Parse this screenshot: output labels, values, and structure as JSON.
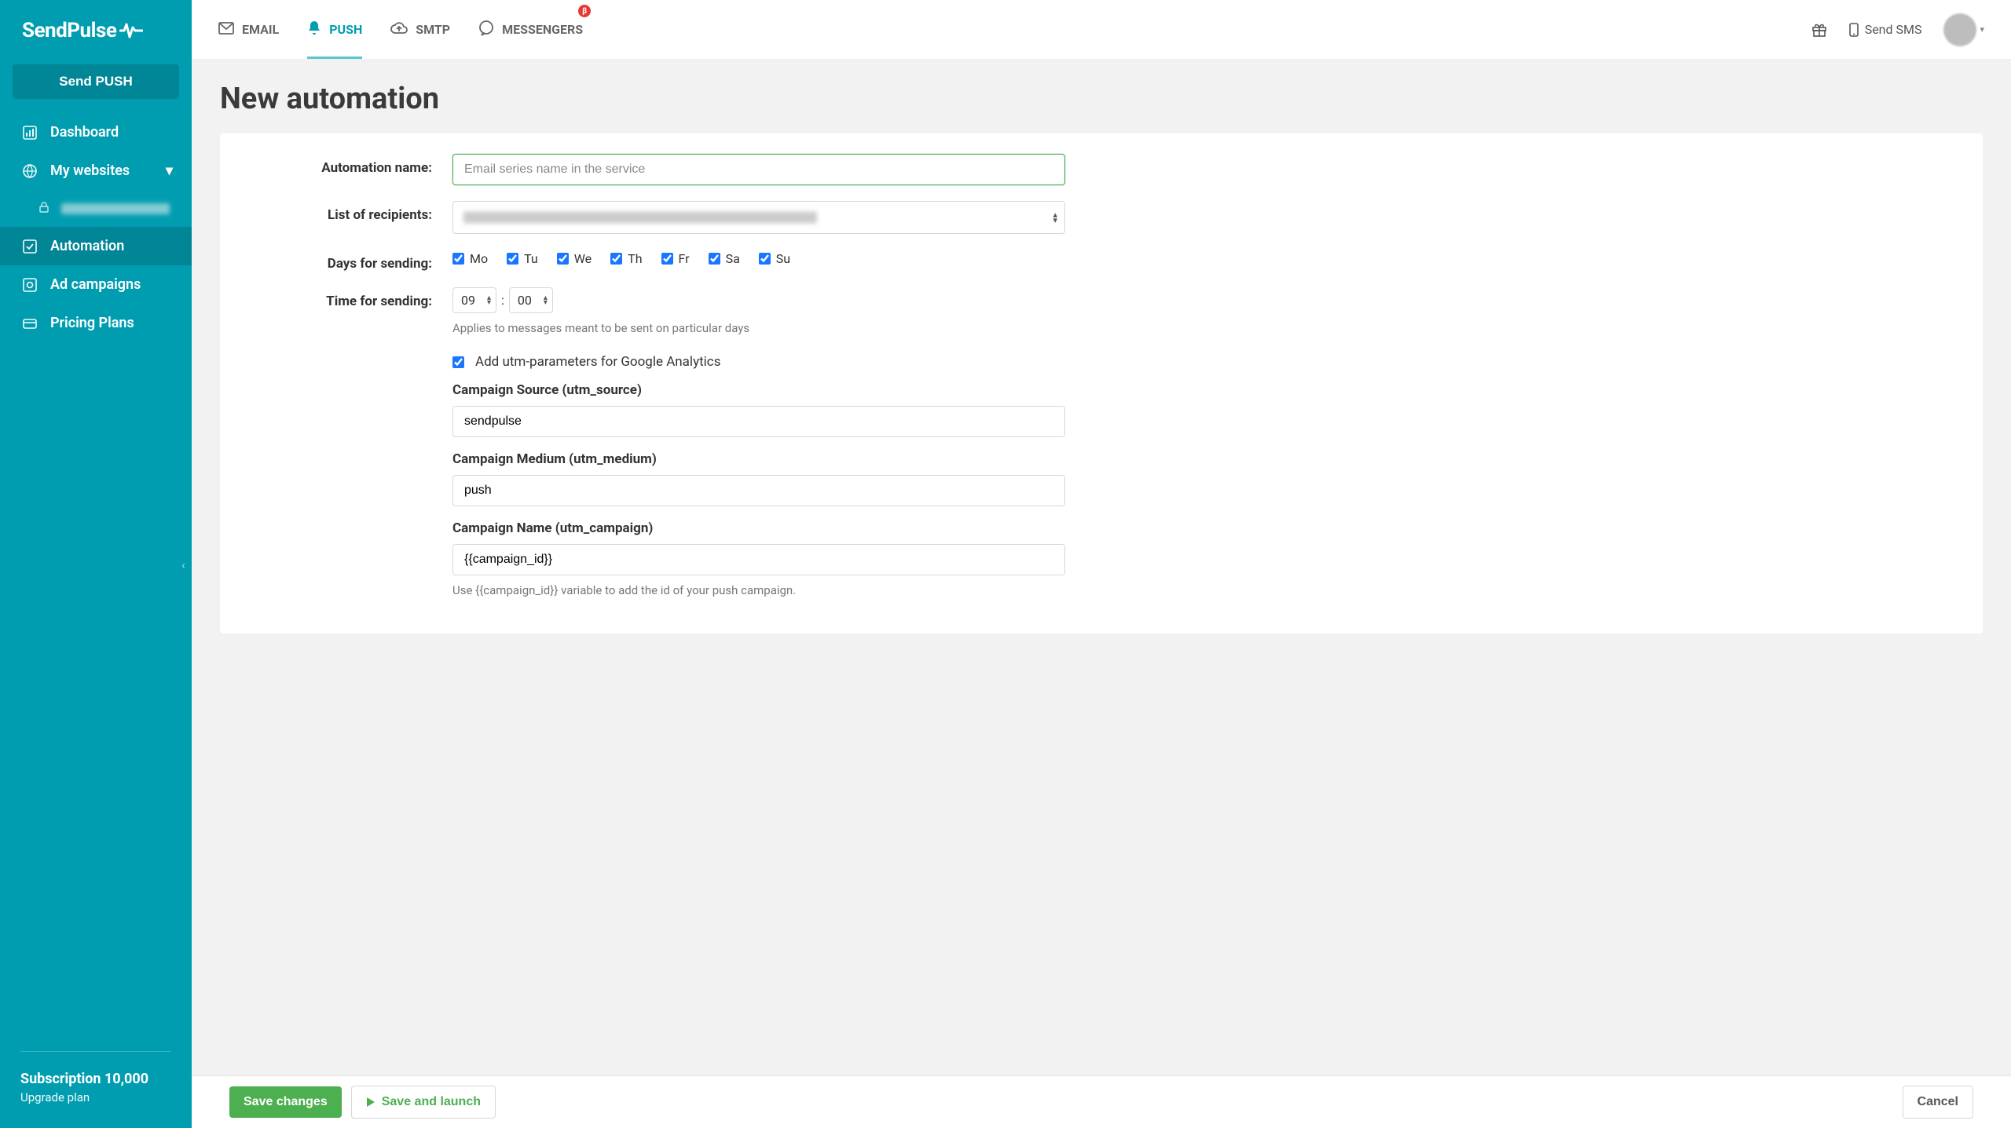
{
  "brand": "SendPulse",
  "sidebar": {
    "send_push": "Send PUSH",
    "items": [
      {
        "label": "Dashboard"
      },
      {
        "label": "My websites"
      },
      {
        "label": "Automation"
      },
      {
        "label": "Ad campaigns"
      },
      {
        "label": "Pricing Plans"
      }
    ],
    "subscription_title": "Subscription 10,000",
    "subscription_sub": "Upgrade plan"
  },
  "topnav": {
    "email": "EMAIL",
    "push": "PUSH",
    "smtp": "SMTP",
    "messengers": "MESSENGERS",
    "messengers_badge": "β",
    "send_sms": "Send SMS"
  },
  "page": {
    "title": "New automation"
  },
  "form": {
    "automation_name_label": "Automation name:",
    "automation_name_placeholder": "Email series name in the service",
    "recipients_label": "List of recipients:",
    "days_label": "Days for sending:",
    "days": [
      {
        "key": "mo",
        "label": "Mo",
        "checked": true
      },
      {
        "key": "tu",
        "label": "Tu",
        "checked": true
      },
      {
        "key": "we",
        "label": "We",
        "checked": true
      },
      {
        "key": "th",
        "label": "Th",
        "checked": true
      },
      {
        "key": "fr",
        "label": "Fr",
        "checked": true
      },
      {
        "key": "sa",
        "label": "Sa",
        "checked": true
      },
      {
        "key": "su",
        "label": "Su",
        "checked": true
      }
    ],
    "time_label": "Time for sending:",
    "time_hour": "09",
    "time_minute": "00",
    "time_help": "Applies to messages meant to be sent on particular days",
    "utm_check_label": "Add utm-parameters for Google Analytics",
    "utm_source_label": "Campaign Source (utm_source)",
    "utm_source_value": "sendpulse",
    "utm_medium_label": "Campaign Medium (utm_medium)",
    "utm_medium_value": "push",
    "utm_campaign_label": "Campaign Name (utm_campaign)",
    "utm_campaign_value": "{{campaign_id}}",
    "utm_campaign_help": "Use {{campaign_id}} variable to add the id of your push campaign."
  },
  "footer": {
    "save": "Save changes",
    "save_launch": "Save and launch",
    "cancel": "Cancel"
  }
}
